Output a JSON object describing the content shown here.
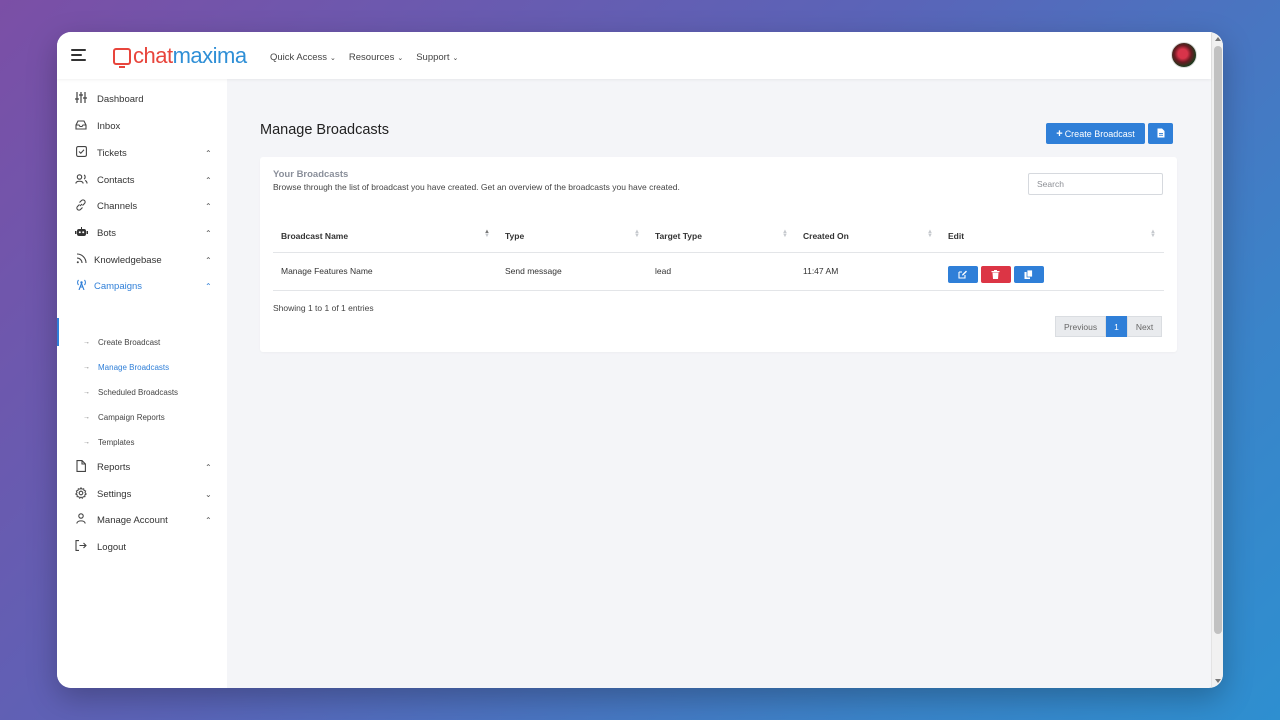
{
  "header": {
    "logo_chat": "chat",
    "logo_maxima": "maxima",
    "nav": [
      {
        "label": "Quick Access"
      },
      {
        "label": "Resources"
      },
      {
        "label": "Support"
      }
    ]
  },
  "sidebar": {
    "items": [
      {
        "label": "Dashboard",
        "icon": "sliders-icon"
      },
      {
        "label": "Inbox",
        "icon": "inbox-icon"
      },
      {
        "label": "Tickets",
        "icon": "ticket-check-icon"
      },
      {
        "label": "Contacts",
        "icon": "users-icon"
      },
      {
        "label": "Channels",
        "icon": "link-icon"
      },
      {
        "label": "Bots",
        "icon": "robot-icon"
      },
      {
        "label": "Knowledgebase",
        "icon": "rss-icon"
      },
      {
        "label": "Campaigns",
        "icon": "broadcast-icon"
      },
      {
        "label": "Reports",
        "icon": "file-icon"
      },
      {
        "label": "Settings",
        "icon": "gear-icon"
      },
      {
        "label": "Manage Account",
        "icon": "user-icon"
      },
      {
        "label": "Logout",
        "icon": "logout-icon"
      }
    ],
    "campaign_sub": [
      {
        "label": "Create Broadcast"
      },
      {
        "label": "Manage Broadcasts"
      },
      {
        "label": "Scheduled Broadcasts"
      },
      {
        "label": "Campaign Reports"
      },
      {
        "label": "Templates"
      }
    ]
  },
  "main": {
    "title": "Manage Broadcasts",
    "create_button": "Create Broadcast",
    "card": {
      "heading": "Your Broadcasts",
      "subtitle": "Browse through the list of broadcast you have created. Get an overview of the broadcasts you have created.",
      "search_placeholder": "Search"
    },
    "table": {
      "columns": [
        "Broadcast Name",
        "Type",
        "Target Type",
        "Created On",
        "Edit"
      ],
      "rows": [
        [
          "Manage Features Name",
          "Send message",
          "lead",
          "11:47 AM"
        ]
      ]
    },
    "showing": "Showing 1 to 1 of 1 entries",
    "pagination": {
      "previous": "Previous",
      "current": "1",
      "next": "Next"
    }
  },
  "colors": {
    "accent": "#2f7fd8",
    "danger": "#dc3545",
    "brand_red": "#e8453c",
    "brand_blue": "#2f8fd6"
  }
}
